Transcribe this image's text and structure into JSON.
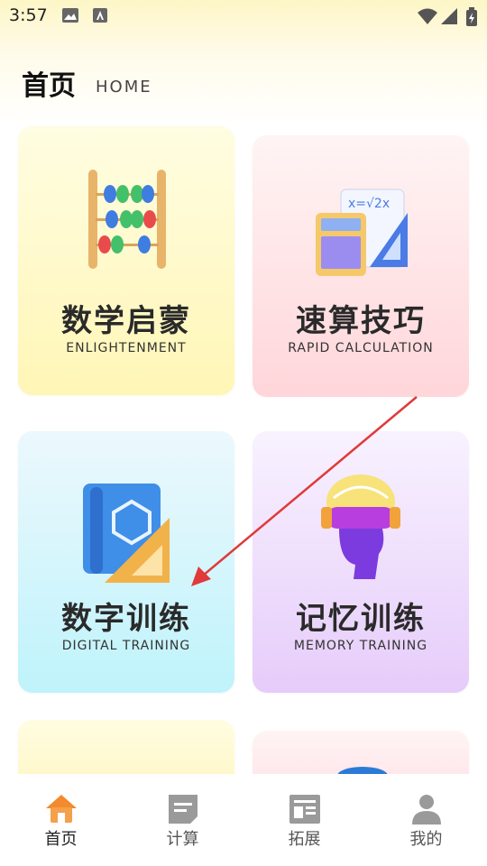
{
  "status_bar": {
    "time": "3:57"
  },
  "header": {
    "title": "首页",
    "subtitle": "HOME"
  },
  "cards": [
    {
      "title": "数学启蒙",
      "subtitle": "ENLIGHTENMENT"
    },
    {
      "title": "速算技巧",
      "subtitle": "RAPID CALCULATION"
    },
    {
      "title": "数字训练",
      "subtitle": "DIGITAL TRAINING"
    },
    {
      "title": "记忆训练",
      "subtitle": "MEMORY TRAINING"
    }
  ],
  "nav": {
    "items": [
      {
        "label": "首页",
        "icon": "home-icon",
        "active": true
      },
      {
        "label": "计算",
        "icon": "calculate-icon"
      },
      {
        "label": "拓展",
        "icon": "expand-icon"
      },
      {
        "label": "我的",
        "icon": "profile-icon"
      }
    ],
    "active_color": "#f28a2e",
    "inactive_color": "#9a9a9a"
  }
}
